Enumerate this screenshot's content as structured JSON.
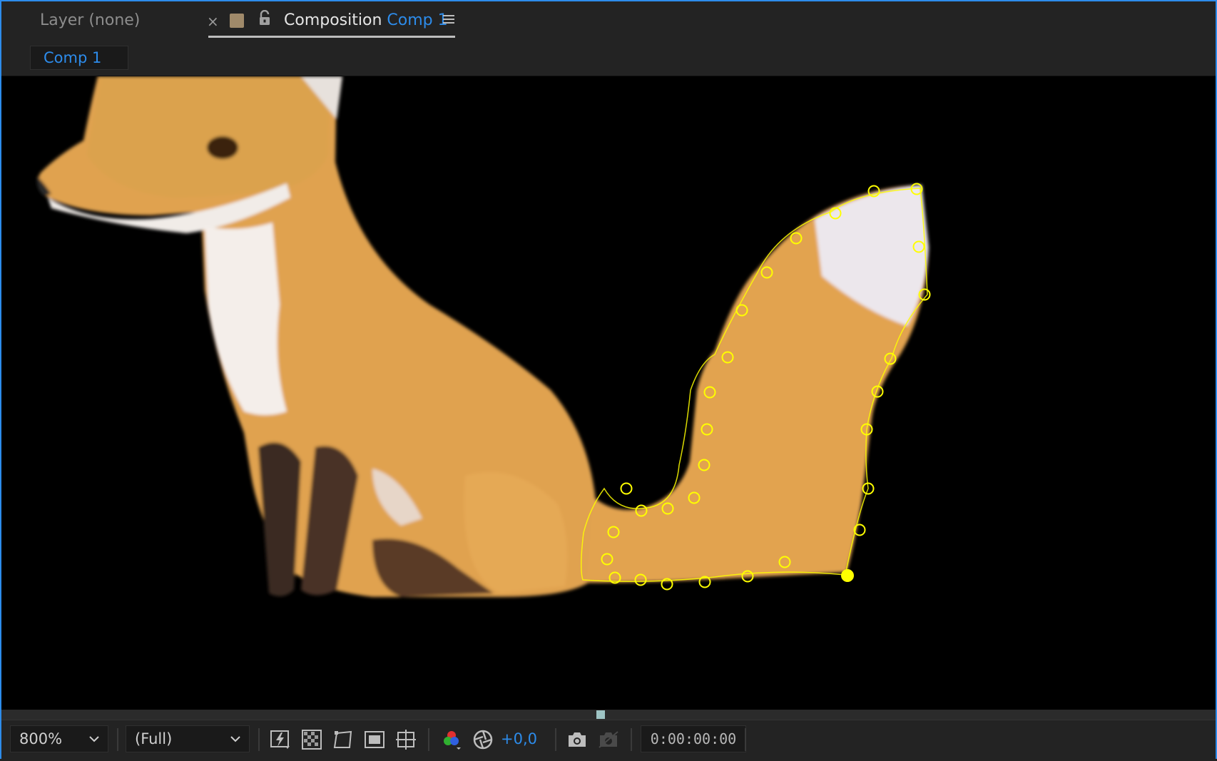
{
  "tabs": {
    "layer_tab": "Layer (none)",
    "close_glyph": "×",
    "comp_tab_prefix": "Composition",
    "comp_tab_name": "Comp 1",
    "menu_icon": "hamburger-menu-icon",
    "label_swatch_color": "#a08a6a"
  },
  "breadcrumb": {
    "comp_name": "Comp 1"
  },
  "viewer": {
    "background": "#000000",
    "content": "fox-image-with-mask-path",
    "mask_color": "#ffff00"
  },
  "toolbar": {
    "zoom": "800%",
    "resolution": "(Full)",
    "exposure": "+0,0",
    "timecode": "0:00:00:00",
    "icons": [
      "fast-preview-icon",
      "transparency-grid-icon",
      "mask-path-visibility-icon",
      "region-of-interest-icon",
      "guides-grid-icon",
      "color-channels-icon",
      "color-management-icon",
      "snapshot-camera-icon",
      "show-snapshot-icon"
    ]
  },
  "colors": {
    "accent": "#2d8ceb",
    "panel": "#232323"
  }
}
